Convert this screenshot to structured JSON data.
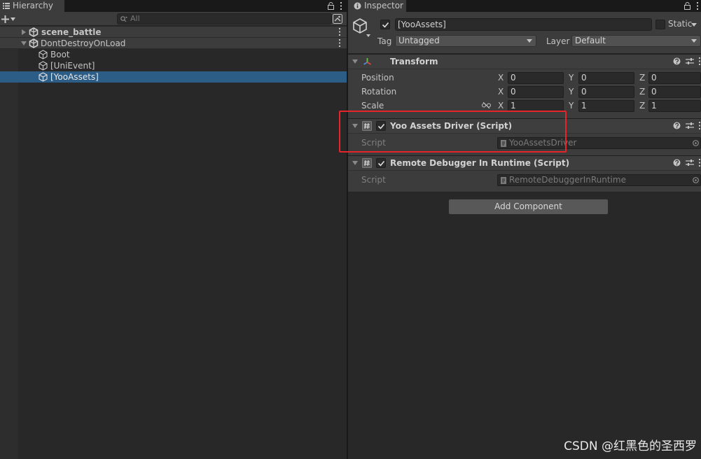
{
  "hierarchy": {
    "tab_label": "Hierarchy",
    "search_placeholder": "All",
    "rows": [
      {
        "label": "scene_battle"
      },
      {
        "label": "DontDestroyOnLoad"
      },
      {
        "label": "Boot"
      },
      {
        "label": "[UniEvent]"
      },
      {
        "label": "[YooAssets]"
      }
    ]
  },
  "inspector": {
    "tab_label": "Inspector",
    "object_name": "[YooAssets]",
    "static_label": "Static",
    "tag_label": "Tag",
    "tag_value": "Untagged",
    "layer_label": "Layer",
    "layer_value": "Default",
    "transform": {
      "title": "Transform",
      "rows": [
        {
          "label": "Position",
          "x": "0",
          "y": "0",
          "z": "0"
        },
        {
          "label": "Rotation",
          "x": "0",
          "y": "0",
          "z": "0"
        },
        {
          "label": "Scale",
          "x": "1",
          "y": "1",
          "z": "1"
        }
      ],
      "axis_x": "X",
      "axis_y": "Y",
      "axis_z": "Z"
    },
    "components": [
      {
        "title": "Yoo Assets Driver (Script)",
        "script_label": "Script",
        "script_value": "YooAssetsDriver"
      },
      {
        "title": "Remote Debugger In Runtime (Script)",
        "script_label": "Script",
        "script_value": "RemoteDebuggerInRuntime"
      }
    ],
    "add_component_label": "Add Component"
  },
  "watermark": "CSDN @红黑色的圣西罗",
  "colors": {
    "selection": "#2c5d87",
    "highlight_box": "#e8242b",
    "panel": "#282828"
  }
}
